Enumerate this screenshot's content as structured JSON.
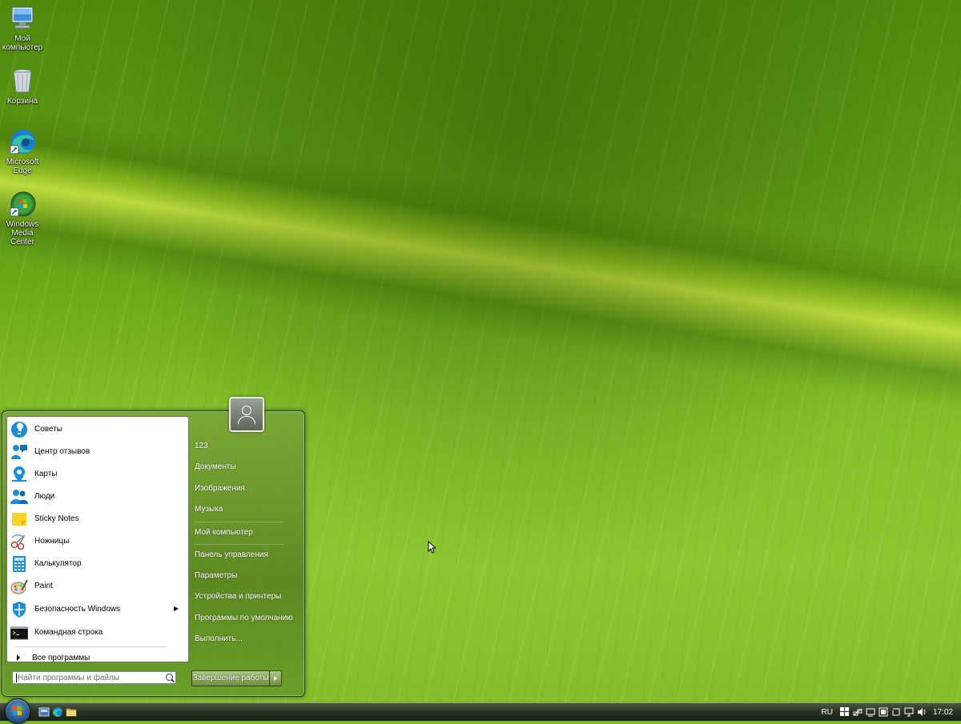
{
  "desktop": {
    "icons": [
      {
        "name": "my-computer",
        "label": "Мой компьютер"
      },
      {
        "name": "recycle-bin",
        "label": "Корзина"
      },
      {
        "name": "edge",
        "label": "Microsoft Edge"
      },
      {
        "name": "media-center",
        "label": "Windows Media Center"
      }
    ]
  },
  "start_menu": {
    "programs": [
      {
        "label": "Советы",
        "icon": "tips-icon"
      },
      {
        "label": "Центр отзывов",
        "icon": "feedback-hub-icon"
      },
      {
        "label": "Карты",
        "icon": "maps-icon"
      },
      {
        "label": "Люди",
        "icon": "people-icon"
      },
      {
        "label": "Sticky Notes",
        "icon": "sticky-notes-icon"
      },
      {
        "label": "Ножницы",
        "icon": "snipping-tool-icon"
      },
      {
        "label": "Калькулятор",
        "icon": "calculator-icon"
      },
      {
        "label": "Paint",
        "icon": "paint-icon"
      },
      {
        "label": "Безопасность Windows",
        "icon": "windows-security-icon"
      },
      {
        "label": "Командная строка",
        "icon": "command-prompt-icon"
      }
    ],
    "all_programs": "Все программы",
    "search_placeholder": "Найти программы и файлы",
    "right_items": [
      {
        "label": "123"
      },
      {
        "label": "Документы"
      },
      {
        "label": "Изображения"
      },
      {
        "label": "Музыка"
      },
      {
        "label": "Мой компьютер"
      },
      {
        "label": "Панель управления"
      },
      {
        "label": "Параметры"
      },
      {
        "label": "Устройства и принтеры"
      },
      {
        "label": "Программы по умолчанию"
      },
      {
        "label": "Выполнить..."
      }
    ],
    "shutdown_label": "Завершение работы"
  },
  "taskbar": {
    "language": "RU",
    "clock": "17:02"
  },
  "colors": {
    "accent_green": "#6f8f3f",
    "taskbar": "#26301f"
  }
}
